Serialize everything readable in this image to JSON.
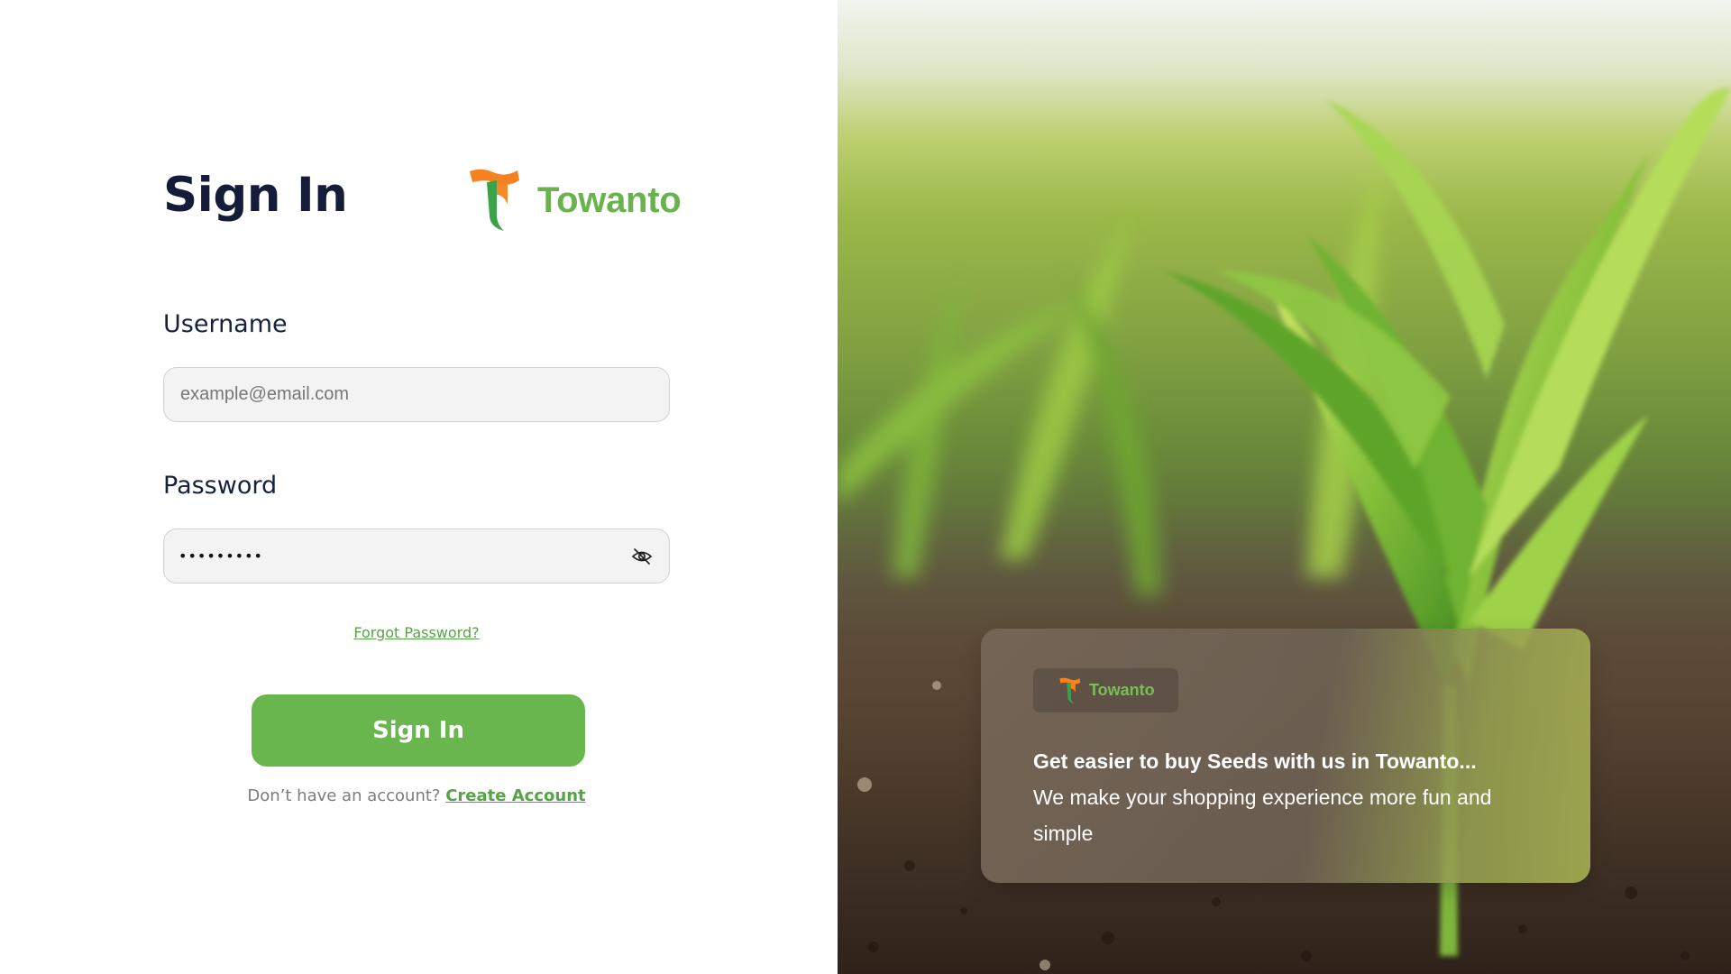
{
  "signin": {
    "title": "Sign In",
    "brand": "Towanto",
    "username": {
      "label": "Username",
      "placeholder": "example@email.com"
    },
    "password": {
      "label": "Password",
      "masked_value": "•••••••••"
    },
    "forgot_link": "Forgot Password?",
    "submit_button": "Sign In",
    "no_account_text": "Don’t have an account?",
    "create_account_link": "Create Account"
  },
  "promo": {
    "brand": "Towanto",
    "headline": "Get easier to buy Seeds with us in Towanto...",
    "body": "We make your shopping experience more fun and simple"
  },
  "colors": {
    "brand_green": "#6ab24e",
    "brand_orange": "#f5821f",
    "title_navy": "#141c3a"
  },
  "icons": {
    "logo": "towanto-logo-icon",
    "password_toggle": "eye-off-icon"
  }
}
